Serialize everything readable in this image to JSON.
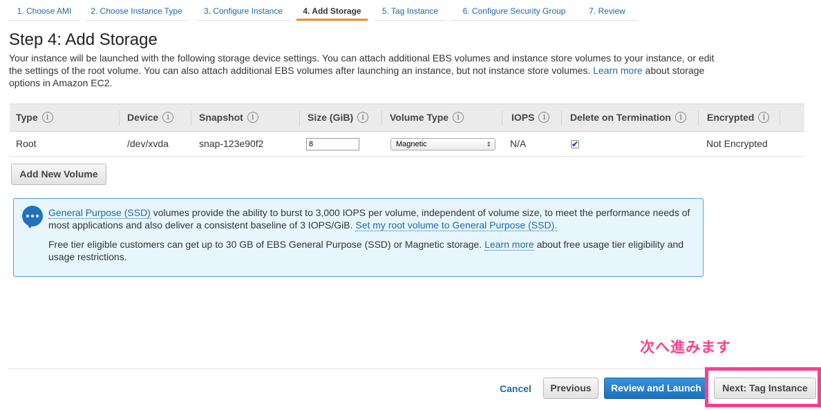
{
  "wizard": {
    "steps": [
      {
        "label": "1. Choose AMI"
      },
      {
        "label": "2. Choose Instance Type"
      },
      {
        "label": "3. Configure Instance"
      },
      {
        "label": "4. Add Storage"
      },
      {
        "label": "5. Tag Instance"
      },
      {
        "label": "6. Configure Security Group"
      },
      {
        "label": "7. Review"
      }
    ],
    "active_step": 4
  },
  "page": {
    "title": "Step 4: Add Storage",
    "intro_text": "Your instance will be launched with the following storage device settings. You can attach additional EBS volumes and instance store volumes to your instance, or edit the settings of the root volume. You can also attach additional EBS volumes after launching an instance, but not instance store volumes.",
    "intro_link": "Learn more",
    "intro_suffix": "about storage options in Amazon EC2."
  },
  "table": {
    "columns": [
      "Type",
      "Device",
      "Snapshot",
      "Size (GiB)",
      "Volume Type",
      "IOPS",
      "Delete on Termination",
      "Encrypted"
    ],
    "info_icon": "i",
    "rows": [
      {
        "type": "Root",
        "device": "/dev/xvda",
        "snapshot": "snap-123e90f2",
        "size": "8",
        "volume_type": "Magnetic",
        "iops": "N/A",
        "delete_on_termination": true,
        "encrypted": "Not Encrypted"
      }
    ]
  },
  "add_volume_button": "Add New Volume",
  "info_box": {
    "icon": "chat-bubble-icon",
    "link1": "General Purpose (SSD)",
    "text1": "volumes provide the ability to burst to 3,000 IOPS per volume, independent of volume size, to meet the performance needs of most applications and also deliver a consistent baseline of 3 IOPS/GiB.",
    "link2": "Set my root volume to General Purpose (SSD).",
    "text2": "Free tier eligible customers can get up to 30 GB of EBS General Purpose (SSD) or Magnetic storage.",
    "link3": "Learn more",
    "text3": "about free usage tier eligibility and usage restrictions."
  },
  "footer": {
    "cancel": "Cancel",
    "previous": "Previous",
    "review_launch": "Review and Launch",
    "next": "Next: Tag Instance"
  },
  "annotation": {
    "text": "次へ進みます",
    "color": "#ff3d8b"
  },
  "colors": {
    "link": "#1a69b0",
    "active_tab_underline": "#e58f22",
    "primary_button": "#1b6fc0",
    "info_box_bg": "#e7f6fc",
    "info_box_border": "#4aa3d6"
  }
}
